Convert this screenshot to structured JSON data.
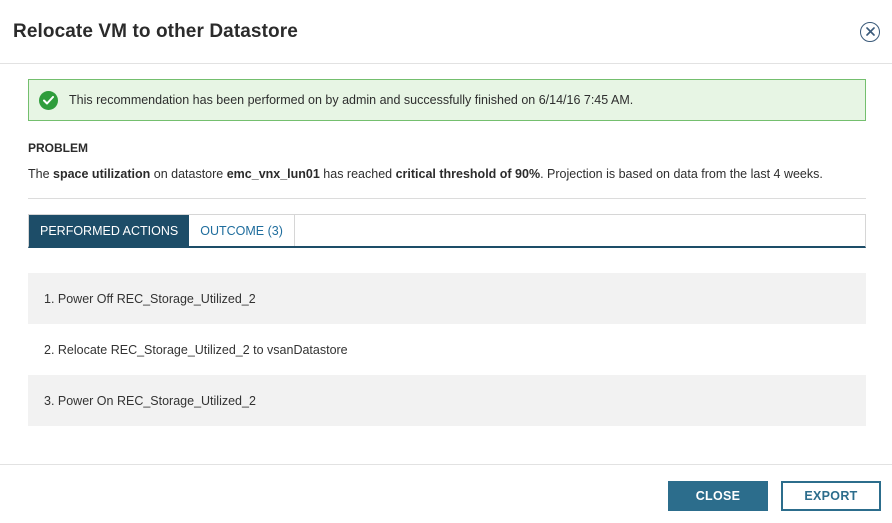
{
  "dialog": {
    "title": "Relocate VM to other Datastore",
    "close_icon": "close-x-icon"
  },
  "banner": {
    "icon": "check-circle-icon",
    "message": "This recommendation has been performed on by admin and successfully finished on 6/14/16 7:45 AM."
  },
  "problem": {
    "label": "PROBLEM",
    "parts": [
      {
        "text": "The ",
        "bold": false
      },
      {
        "text": "space utilization",
        "bold": true
      },
      {
        "text": " on datastore ",
        "bold": false
      },
      {
        "text": "emc_vnx_lun01",
        "bold": true
      },
      {
        "text": " has reached ",
        "bold": false
      },
      {
        "text": "critical threshold of 90%",
        "bold": true
      },
      {
        "text": ". Projection is based on data from the last 4 weeks.",
        "bold": false
      }
    ]
  },
  "tabs": [
    {
      "label": "PERFORMED ACTIONS",
      "active": true
    },
    {
      "label": "OUTCOME (3)",
      "active": false
    }
  ],
  "actions": [
    "1. Power Off REC_Storage_Utilized_2",
    "2. Relocate REC_Storage_Utilized_2 to vsanDatastore",
    "3. Power On REC_Storage_Utilized_2"
  ],
  "footer": {
    "close_label": "CLOSE",
    "export_label": "EXPORT"
  },
  "colors": {
    "accent": "#1d4d68",
    "button": "#2c6d8c",
    "success_border": "#74bf6e",
    "success_bg": "#e7f5e4",
    "success_icon": "#2f9d3c"
  }
}
